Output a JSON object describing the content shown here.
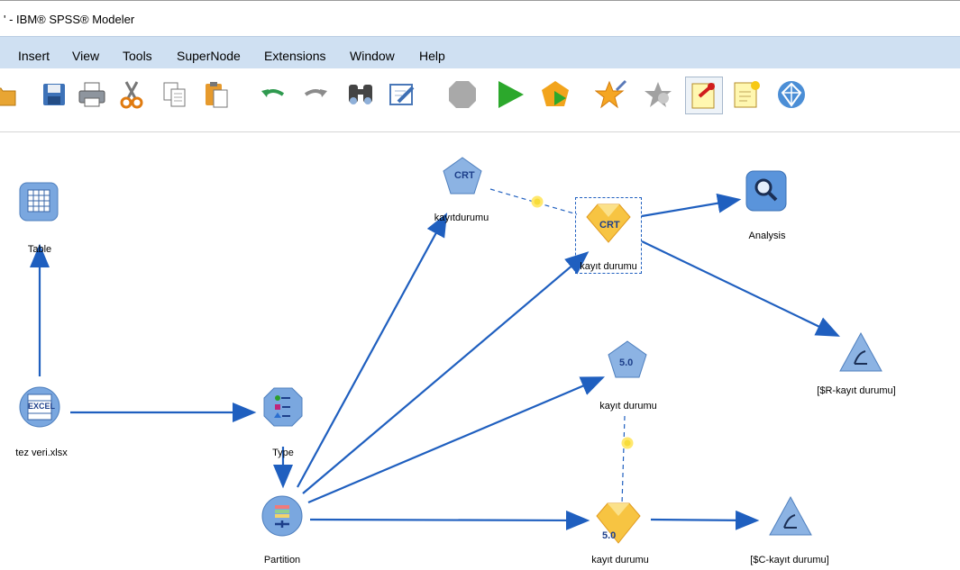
{
  "app": {
    "title": "' - IBM® SPSS® Modeler"
  },
  "menu": [
    "Insert",
    "View",
    "Tools",
    "SuperNode",
    "Extensions",
    "Window",
    "Help"
  ],
  "toolbar": [
    "open-icon",
    "save-icon",
    "print-icon",
    "cut-icon",
    "copy-icon",
    "paste-icon",
    "undo-icon",
    "redo-icon",
    "find-icon",
    "edit-icon",
    "stop-icon",
    "run-icon",
    "run-selection-icon",
    "star-icon",
    "star-add-icon",
    "annotation-pin-icon",
    "new-comment-icon",
    "model-icon"
  ],
  "nodes": {
    "table": "Table",
    "excel": "tez veri.xlsx",
    "type": "Type",
    "partition": "Partition",
    "crt_build": "kayıtdurumu",
    "crt_model": "kayıt durumu",
    "analysis": "Analysis",
    "eval_r": "[$R-kayıt durumu]",
    "c50_build": "kayıt durumu",
    "c50_model": "kayıt durumu",
    "eval_c": "[$C-kayıt durumu]"
  },
  "glyphs": {
    "crt": "CRT",
    "c50": "5.0",
    "excel": "EXCEL"
  },
  "colors": {
    "link": "#1f5fbf",
    "menubar": "#cfe0f2",
    "node_blue": "#7fa9dc",
    "model_gold": "#f5b93a"
  }
}
